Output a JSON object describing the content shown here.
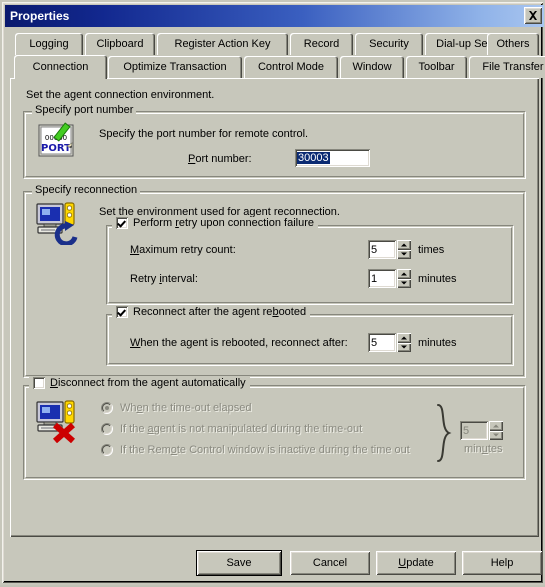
{
  "window": {
    "title": "Properties",
    "close_label": "✕"
  },
  "tabs": {
    "row_top": [
      {
        "label": "Logging",
        "selected": false
      },
      {
        "label": "Clipboard",
        "selected": false
      },
      {
        "label": "Register Action Key",
        "selected": false
      },
      {
        "label": "Record",
        "selected": false
      },
      {
        "label": "Security",
        "selected": false
      },
      {
        "label": "Dial-up Settings",
        "selected": false
      },
      {
        "label": "Others",
        "selected": false
      }
    ],
    "row_bottom": [
      {
        "label": "Connection",
        "selected": true
      },
      {
        "label": "Optimize Transaction",
        "selected": false
      },
      {
        "label": "Control Mode",
        "selected": false
      },
      {
        "label": "Window",
        "selected": false
      },
      {
        "label": "Toolbar",
        "selected": false
      },
      {
        "label": "File Transfer",
        "selected": false
      }
    ]
  },
  "page": {
    "intro": "Set the agent connection environment.",
    "port_group": {
      "legend": "Specify port number",
      "icon_name": "port-icon",
      "icon_digits": "00000",
      "icon_word": "PORT",
      "description": "Specify the port number for remote control.",
      "field_label_pre": "P",
      "field_label_post": "ort number:",
      "port_value": "30003"
    },
    "reconnect_group": {
      "legend": "Specify reconnection",
      "icon_name": "reconnect-computer-icon",
      "description": "Set the environment used for agent reconnection.",
      "retry_box": {
        "checkbox_checked": true,
        "label_pre": "Perform ",
        "label_key": "r",
        "label_post": "etry upon connection failure",
        "max_retry": {
          "label_key": "M",
          "label_post": "aximum retry count:",
          "value": "5",
          "unit": "times"
        },
        "retry_interval": {
          "label_pre": "Retry ",
          "label_key": "i",
          "label_post": "nterval:",
          "value": "1",
          "unit": "minutes"
        }
      },
      "reboot_box": {
        "checkbox_checked": true,
        "label_pre": "Reconnect after the agent re",
        "label_key": "b",
        "label_post": "ooted",
        "row": {
          "label_key": "W",
          "label_post": "hen the agent is rebooted, reconnect after:",
          "value": "5",
          "unit": "minutes"
        }
      }
    },
    "disconnect_group": {
      "legend_key": "D",
      "legend_post": "isconnect from the agent automatically",
      "checkbox_checked": false,
      "enabled": false,
      "icon_name": "disconnect-computer-icon",
      "options": [
        {
          "label_pre": "Wh",
          "label_key": "e",
          "label_post": "n the time-out elapsed",
          "selected": true
        },
        {
          "label_pre": "If the ",
          "label_key": "a",
          "label_post": "gent is not manipulated during the time-out",
          "selected": false
        },
        {
          "label_pre": "If the Rem",
          "label_key": "o",
          "label_post": "te Control window is inactive during the time out",
          "selected": false
        }
      ],
      "timeout": {
        "value": "5",
        "unit_pre": "min",
        "unit_key": "u",
        "unit_post": "tes"
      }
    }
  },
  "buttons": [
    {
      "label": "Save",
      "default": true,
      "accel": ""
    },
    {
      "label": "Cancel",
      "default": false,
      "accel": ""
    },
    {
      "label_pre": "",
      "label_key": "U",
      "label_post": "pdate",
      "default": false
    },
    {
      "label": "Help",
      "default": false,
      "accel": ""
    }
  ],
  "button_labels": {
    "save": "Save",
    "cancel": "Cancel",
    "update_key": "U",
    "update_post": "pdate",
    "help": "Help"
  },
  "colors": {
    "face": "#c7c7bb",
    "title_dark": "#0a1a6e",
    "title_light": "#a9c6f0",
    "selection": "#0a2a72",
    "disabled_text": "#8a8a80",
    "port_word": "#1a1aaa",
    "pencil": "#44cc22",
    "red_x": "#cc0000"
  }
}
